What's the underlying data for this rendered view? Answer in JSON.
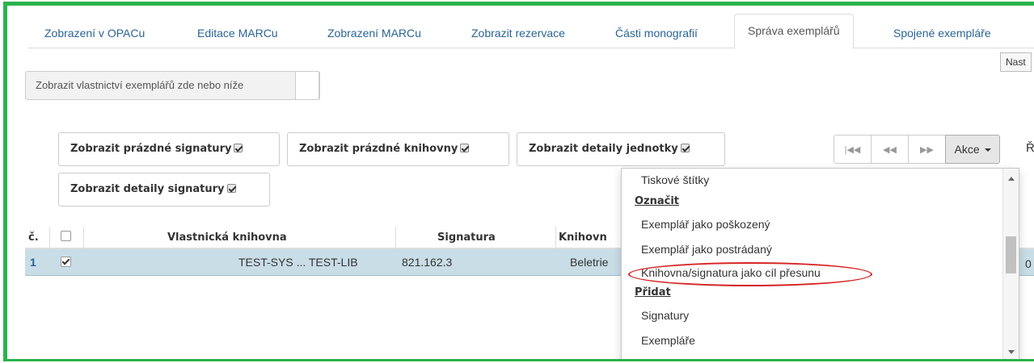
{
  "tabs": [
    {
      "label": "Zobrazení v OPACu"
    },
    {
      "label": "Editace MARCu"
    },
    {
      "label": "Zobrazení MARCu"
    },
    {
      "label": "Zobrazit rezervace"
    },
    {
      "label": "Části monografií"
    },
    {
      "label": "Správa exemplářů",
      "active": true
    },
    {
      "label": "Spojené exempláře"
    }
  ],
  "tooltip_stub": "Nast",
  "ownership_button": "Zobrazit vlastnictví exemplářů zde nebo níže",
  "toggles": [
    {
      "label": "Zobrazit prázdné signatury",
      "checked": true
    },
    {
      "label": "Zobrazit prázdné knihovny",
      "checked": true
    },
    {
      "label": "Zobrazit detaily jednotky",
      "checked": true
    },
    {
      "label": "Zobrazit detaily signatury",
      "checked": true
    }
  ],
  "pager": {
    "actions_label": "Akce",
    "next_stub": "Ř"
  },
  "table": {
    "headers": {
      "num": "č.",
      "owning_library": "Vlastnická knihovna",
      "call_number": "Signatura",
      "library": "Knihovn"
    },
    "row": {
      "num": "1",
      "checked": true,
      "owning_library": "TEST-SYS ... TEST-LIB",
      "call_number": "821.162.3",
      "library": "Beletrie",
      "trailing": "0"
    }
  },
  "menu": {
    "items": [
      {
        "type": "item",
        "label": "Tiskové štítky"
      },
      {
        "type": "header",
        "label": "Označit"
      },
      {
        "type": "item",
        "label": "Exemplář jako poškozený"
      },
      {
        "type": "item",
        "label": "Exemplář jako postrádaný"
      },
      {
        "type": "item",
        "label": "Knihovna/signatura jako cíl přesunu",
        "highlighted": true
      },
      {
        "type": "header",
        "label": "Přidat"
      },
      {
        "type": "item",
        "label": "Signatury"
      },
      {
        "type": "item",
        "label": "Exempláře"
      }
    ]
  },
  "colors": {
    "frame": "#2bb34a",
    "link": "#2a6496",
    "row_selected": "#c9dde6",
    "annotation": "#d62424"
  }
}
